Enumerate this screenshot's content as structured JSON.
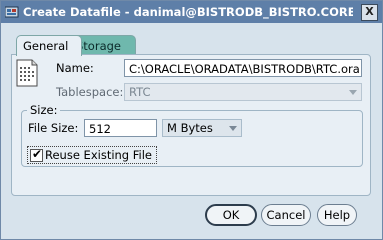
{
  "window": {
    "title": "Create Datafile - danimal@BISTRODB_BISTRO.CORESTREET.C...",
    "close_glyph": "X"
  },
  "tabs": [
    {
      "label": "General",
      "active": true
    },
    {
      "label": "Storage",
      "active": false
    }
  ],
  "general": {
    "name_label": "Name:",
    "name_value": "C:\\ORACLE\\ORADATA\\BISTRODB\\RTC.ora",
    "tablespace_label": "Tablespace:",
    "tablespace_value": "RTC",
    "size_group_label": "Size:",
    "file_size_label": "File Size:",
    "file_size_value": "512",
    "unit_value": "M Bytes",
    "reuse_label": "Reuse Existing File",
    "reuse_checked": true
  },
  "buttons": {
    "ok": "OK",
    "cancel": "Cancel",
    "help": "Help"
  },
  "icons": {
    "title_icon": "oracle-app-icon",
    "file_icon": "datafile-icon"
  },
  "colors": {
    "titlebar": "#5e7fa8",
    "storage_tab": "#6fb8ad",
    "dialog_bg": "#d7e3ec"
  }
}
